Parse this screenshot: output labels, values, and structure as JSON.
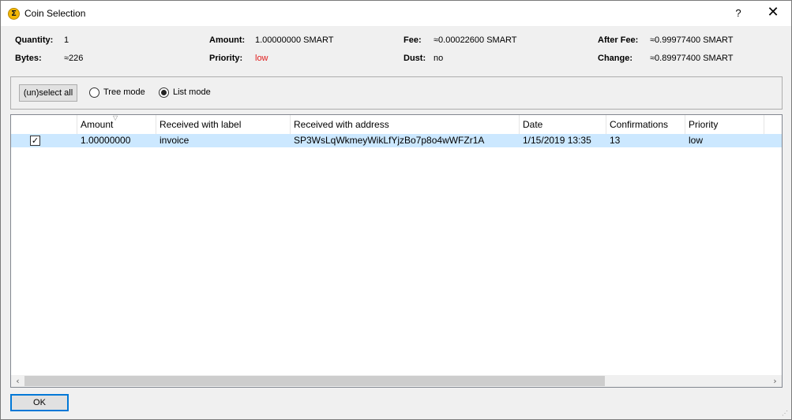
{
  "window": {
    "title": "Coin Selection",
    "icon_glyph": "Σ",
    "help_label": "?",
    "close_label": "✕"
  },
  "summary": {
    "quantity_label": "Quantity:",
    "quantity_value": "1",
    "bytes_label": "Bytes:",
    "bytes_value": "≈226",
    "amount_label": "Amount:",
    "amount_value": "1.00000000 SMART",
    "priority_label": "Priority:",
    "priority_value": "low",
    "fee_label": "Fee:",
    "fee_value": "≈0.00022600 SMART",
    "dust_label": "Dust:",
    "dust_value": "no",
    "afterfee_label": "After Fee:",
    "afterfee_value": "≈0.99977400 SMART",
    "change_label": "Change:",
    "change_value": "≈0.89977400 SMART",
    "priority_color": "#e01b1b"
  },
  "toolbar": {
    "select_all_label": "(un)select all",
    "tree_mode_label": "Tree mode",
    "list_mode_label": "List mode",
    "selected_mode": "list"
  },
  "table": {
    "columns": [
      "Amount",
      "Received with label",
      "Received with address",
      "Date",
      "Confirmations",
      "Priority"
    ],
    "rows": [
      {
        "checked": true,
        "check_glyph": "✓",
        "amount": "1.00000000",
        "label": "invoice",
        "address": "SP3WsLqWkmeyWikLfYjzBo7p8o4wWFZr1A",
        "date": "1/15/2019 13:35",
        "confirmations": "13",
        "priority": "low"
      }
    ],
    "selection_color": "#cce8ff"
  },
  "footer": {
    "ok_label": "OK"
  }
}
